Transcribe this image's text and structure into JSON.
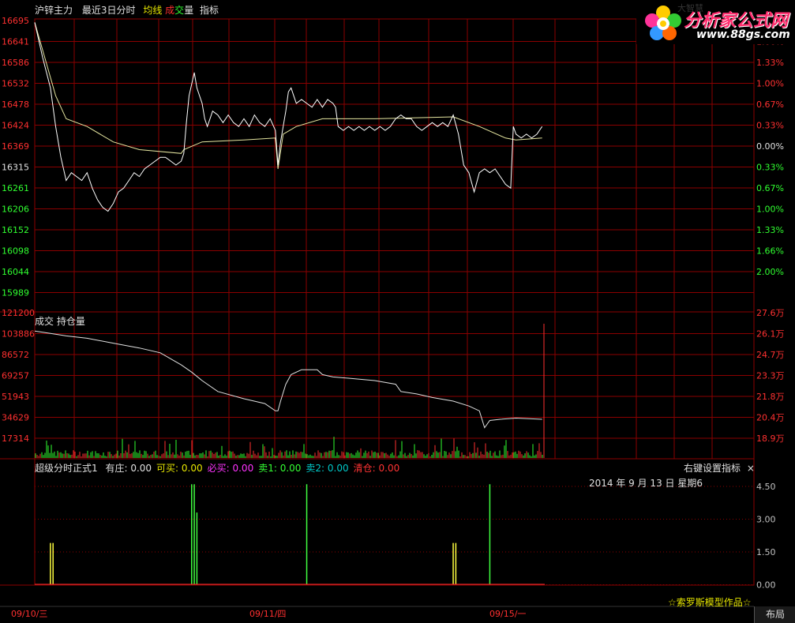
{
  "header": {
    "instrument": "沪锌主力",
    "period": "最近3日分时",
    "avg_line": "均线",
    "volume_a": "成",
    "volume_b": "交",
    "volume_c": "量",
    "indicator": "指标"
  },
  "logo": {
    "title": "分析家公式网",
    "url": "www.88gs.com",
    "faint": "大智慧"
  },
  "price_panel": {
    "left_ticks": [
      "16695",
      "16641",
      "16586",
      "16532",
      "16478",
      "16424",
      "16369",
      "16315",
      "16261",
      "16206",
      "16152",
      "16098",
      "16044",
      "15989"
    ],
    "right_ticks": [
      "1.66%",
      "1.33%",
      "1.00%",
      "0.67%",
      "0.33%",
      "0.00%",
      "0.33%",
      "0.67%",
      "1.00%",
      "1.33%",
      "1.66%",
      "2.00%"
    ]
  },
  "volume_panel": {
    "label": "成交 持仓量",
    "left_ticks": [
      "121200",
      "103886",
      "86572",
      "69257",
      "51943",
      "34629",
      "17314"
    ],
    "right_ticks": [
      "27.6万",
      "26.1万",
      "24.7万",
      "23.3万",
      "21.8万",
      "20.4万",
      "18.9万"
    ]
  },
  "indicator_panel": {
    "name": "超级分时正式1",
    "values": [
      {
        "label": "有庄:",
        "value": "0.00",
        "color": "#e0e0e0"
      },
      {
        "label": "可买:",
        "value": "0.00",
        "color": "#e6e600"
      },
      {
        "label": "必买:",
        "value": "0.00",
        "color": "#ff33ff"
      },
      {
        "label": "卖1:",
        "value": "0.00",
        "color": "#33ff33"
      },
      {
        "label": "卖2:",
        "value": "0.00",
        "color": "#00c8c8"
      },
      {
        "label": "清仓:",
        "value": "0.00",
        "color": "#ff3333"
      }
    ],
    "right_button": "右键设置指标",
    "close": "×",
    "date_text": "2014 年 9 月 13 日 星期6",
    "right_ticks": [
      "4.50",
      "3.00",
      "1.50",
      "0.00"
    ],
    "credit": "☆索罗斯模型作品☆"
  },
  "date_axis": [
    "09/10/三",
    "09/11/四",
    "09/15/一"
  ],
  "layout_button": "布局",
  "colors": {
    "grid": "#8b0000",
    "price": "#ffffff",
    "avg": "#e6e6a0",
    "up": "#ff3030",
    "down": "#30ff30",
    "pos_pct": "#ff3030",
    "neg_pct": "#30ff30",
    "label": "#c0c0c0"
  },
  "chart_data": {
    "type": "line",
    "series": [
      {
        "name": "均线",
        "description": "yellow average price line"
      },
      {
        "name": "成交",
        "description": "volume bars"
      },
      {
        "name": "持仓量",
        "description": "open interest line"
      }
    ],
    "price_series": [
      [
        0,
        16690
      ],
      [
        3,
        16600
      ],
      [
        6,
        16520
      ],
      [
        8,
        16420
      ],
      [
        10,
        16340
      ],
      [
        12,
        16280
      ],
      [
        14,
        16300
      ],
      [
        16,
        16290
      ],
      [
        18,
        16280
      ],
      [
        20,
        16300
      ],
      [
        22,
        16260
      ],
      [
        24,
        16230
      ],
      [
        26,
        16210
      ],
      [
        28,
        16200
      ],
      [
        30,
        16220
      ],
      [
        32,
        16250
      ],
      [
        34,
        16260
      ],
      [
        36,
        16280
      ],
      [
        38,
        16300
      ],
      [
        40,
        16290
      ],
      [
        42,
        16310
      ],
      [
        44,
        16320
      ],
      [
        46,
        16330
      ],
      [
        48,
        16340
      ],
      [
        50,
        16340
      ],
      [
        52,
        16330
      ],
      [
        54,
        16320
      ],
      [
        56,
        16330
      ],
      [
        57,
        16350
      ],
      [
        58,
        16430
      ],
      [
        59,
        16500
      ],
      [
        60,
        16530
      ],
      [
        61,
        16560
      ],
      [
        62,
        16520
      ],
      [
        63,
        16500
      ],
      [
        64,
        16480
      ],
      [
        65,
        16440
      ],
      [
        66,
        16420
      ],
      [
        67,
        16440
      ],
      [
        68,
        16460
      ],
      [
        70,
        16450
      ],
      [
        72,
        16430
      ],
      [
        74,
        16450
      ],
      [
        76,
        16430
      ],
      [
        78,
        16420
      ],
      [
        80,
        16440
      ],
      [
        82,
        16420
      ],
      [
        84,
        16450
      ],
      [
        86,
        16430
      ],
      [
        88,
        16420
      ],
      [
        90,
        16440
      ],
      [
        92,
        16410
      ],
      [
        93,
        16320
      ],
      [
        94,
        16380
      ],
      [
        95,
        16420
      ],
      [
        96,
        16460
      ],
      [
        97,
        16510
      ],
      [
        98,
        16520
      ],
      [
        99,
        16500
      ],
      [
        100,
        16480
      ],
      [
        102,
        16490
      ],
      [
        104,
        16480
      ],
      [
        106,
        16470
      ],
      [
        108,
        16490
      ],
      [
        110,
        16470
      ],
      [
        112,
        16490
      ],
      [
        114,
        16480
      ],
      [
        115,
        16470
      ],
      [
        116,
        16420
      ],
      [
        118,
        16410
      ],
      [
        120,
        16420
      ],
      [
        122,
        16410
      ],
      [
        124,
        16420
      ],
      [
        126,
        16410
      ],
      [
        128,
        16420
      ],
      [
        130,
        16410
      ],
      [
        132,
        16420
      ],
      [
        134,
        16410
      ],
      [
        136,
        16420
      ],
      [
        138,
        16440
      ],
      [
        140,
        16450
      ],
      [
        142,
        16440
      ],
      [
        144,
        16440
      ],
      [
        146,
        16420
      ],
      [
        148,
        16410
      ],
      [
        150,
        16420
      ],
      [
        152,
        16430
      ],
      [
        154,
        16420
      ],
      [
        156,
        16430
      ],
      [
        158,
        16420
      ],
      [
        160,
        16450
      ],
      [
        162,
        16400
      ],
      [
        164,
        16320
      ],
      [
        166,
        16300
      ],
      [
        168,
        16250
      ],
      [
        170,
        16300
      ],
      [
        172,
        16310
      ],
      [
        174,
        16300
      ],
      [
        176,
        16310
      ],
      [
        178,
        16290
      ],
      [
        180,
        16270
      ],
      [
        182,
        16260
      ],
      [
        183,
        16420
      ],
      [
        184,
        16400
      ],
      [
        186,
        16390
      ],
      [
        188,
        16400
      ],
      [
        190,
        16390
      ],
      [
        192,
        16400
      ],
      [
        194,
        16420
      ]
    ],
    "avg_series": [
      [
        0,
        16690
      ],
      [
        8,
        16500
      ],
      [
        12,
        16440
      ],
      [
        20,
        16420
      ],
      [
        30,
        16380
      ],
      [
        40,
        16360
      ],
      [
        56,
        16350
      ],
      [
        57,
        16360
      ],
      [
        64,
        16380
      ],
      [
        80,
        16385
      ],
      [
        92,
        16390
      ],
      [
        93,
        16310
      ],
      [
        95,
        16400
      ],
      [
        100,
        16420
      ],
      [
        110,
        16440
      ],
      [
        130,
        16440
      ],
      [
        160,
        16445
      ],
      [
        170,
        16420
      ],
      [
        180,
        16390
      ],
      [
        184,
        16385
      ],
      [
        194,
        16390
      ]
    ],
    "oi_series": [
      [
        0,
        106000
      ],
      [
        6,
        104000
      ],
      [
        12,
        102000
      ],
      [
        20,
        100000
      ],
      [
        30,
        96000
      ],
      [
        40,
        92000
      ],
      [
        48,
        88000
      ],
      [
        56,
        78000
      ],
      [
        60,
        72000
      ],
      [
        64,
        65000
      ],
      [
        70,
        56000
      ],
      [
        80,
        50000
      ],
      [
        88,
        46000
      ],
      [
        92,
        40000
      ],
      [
        93,
        40000
      ],
      [
        94,
        48000
      ],
      [
        96,
        62000
      ],
      [
        98,
        70000
      ],
      [
        102,
        74000
      ],
      [
        108,
        74000
      ],
      [
        110,
        70000
      ],
      [
        114,
        68000
      ],
      [
        120,
        67000
      ],
      [
        130,
        65000
      ],
      [
        138,
        62000
      ],
      [
        140,
        56000
      ],
      [
        146,
        54000
      ],
      [
        152,
        51000
      ],
      [
        160,
        48000
      ],
      [
        166,
        44000
      ],
      [
        170,
        40000
      ],
      [
        172,
        26000
      ],
      [
        174,
        32000
      ],
      [
        178,
        33000
      ],
      [
        184,
        34000
      ],
      [
        194,
        33000
      ]
    ],
    "ind_spikes": [
      {
        "x": 6,
        "v": 1.9,
        "c": "yellow"
      },
      {
        "x": 7,
        "v": 1.9,
        "c": "yellow"
      },
      {
        "x": 60,
        "v": 4.6,
        "c": "green"
      },
      {
        "x": 61,
        "v": 4.6,
        "c": "green"
      },
      {
        "x": 62,
        "v": 3.3,
        "c": "green"
      },
      {
        "x": 104,
        "v": 4.6,
        "c": "green"
      },
      {
        "x": 160,
        "v": 1.9,
        "c": "yellow"
      },
      {
        "x": 161,
        "v": 1.9,
        "c": "yellow"
      },
      {
        "x": 174,
        "v": 4.6,
        "c": "green"
      }
    ],
    "price_range": [
      15989,
      16695
    ],
    "oi_range": [
      17314,
      121200
    ],
    "ind_range": [
      0,
      4.5
    ]
  }
}
